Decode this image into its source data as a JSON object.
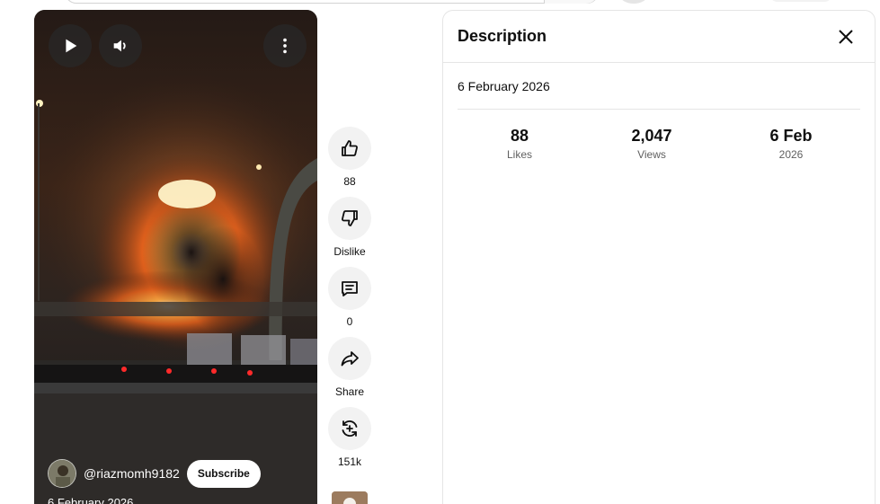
{
  "player": {
    "channel_handle": "@riazmomh9182",
    "subscribe_label": "Subscribe",
    "date_overlay": "6 February 2026"
  },
  "actions": {
    "like_count": "88",
    "dislike_label": "Dislike",
    "comment_count": "0",
    "share_label": "Share",
    "remix_count": "151k"
  },
  "description": {
    "title": "Description",
    "date": "6 February 2026",
    "stats": [
      {
        "value": "88",
        "label": "Likes"
      },
      {
        "value": "2,047",
        "label": "Views"
      },
      {
        "value": "6 Feb",
        "label": "2026"
      }
    ]
  },
  "colors": {
    "button_bg": "#f2f2f2",
    "divider": "#e5e5e5",
    "secondary_text": "#606060"
  },
  "icons": [
    "play-icon",
    "volume-icon",
    "more-vert-icon",
    "like-icon",
    "dislike-icon",
    "comment-icon",
    "share-icon",
    "remix-icon",
    "close-icon"
  ]
}
